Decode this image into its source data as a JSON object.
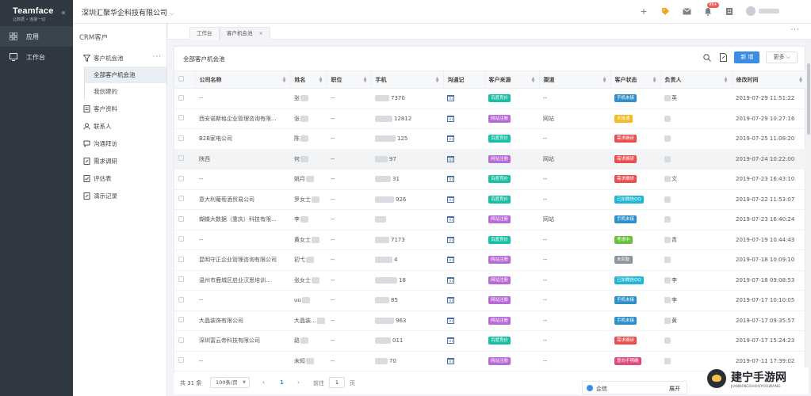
{
  "brand": {
    "name": "Teamface",
    "slogan": "让数据 • 连接一切"
  },
  "rail": {
    "items": [
      {
        "label": "应用"
      },
      {
        "label": "工作台"
      }
    ]
  },
  "header": {
    "company": "深圳汇聚华企科技有限公司",
    "notify_badge": "99+"
  },
  "module": {
    "title": "CRM客户",
    "group_label": "客户机会池",
    "sub_items": [
      {
        "label": "全部客户机会池"
      },
      {
        "label": "我创建的"
      }
    ],
    "items": [
      {
        "label": "客户资料"
      },
      {
        "label": "联系人"
      },
      {
        "label": "沟通拜访"
      },
      {
        "label": "需求调研"
      },
      {
        "label": "评估表"
      },
      {
        "label": "演示记录"
      }
    ]
  },
  "tabs": [
    {
      "label": "工作台"
    },
    {
      "label": "客户机会池"
    }
  ],
  "panel": {
    "title": "全部客户机会池",
    "new_label": "新 增",
    "more_label": "更多"
  },
  "table": {
    "columns": [
      "公司名称",
      "姓名",
      "职位",
      "手机",
      "沟通记",
      "客户来源",
      "渠道",
      "客户状态",
      "负责人",
      "修改时间"
    ],
    "rows": [
      {
        "company": "--",
        "name": "张",
        "title": "--",
        "phone": "7370",
        "source": "百度竞价",
        "channel": "--",
        "status": "手机未接",
        "owner": "英",
        "time": "2019-07-29 11:51:22"
      },
      {
        "company": "西安诺斯格企业管理咨询有限...",
        "name": "张",
        "title": "--",
        "phone": "12812",
        "source": "网站注册",
        "channel": "网站",
        "status": "未接通",
        "owner": "",
        "time": "2019-07-29 10:27:16"
      },
      {
        "company": "B2B家电公司",
        "name": "陈",
        "title": "--",
        "phone": "125",
        "source": "百度竞价",
        "channel": "--",
        "status": "需求确研",
        "owner": "",
        "time": "2019-07-25 11:08:20"
      },
      {
        "company": "陕西",
        "name": "何",
        "title": "--",
        "phone": "97",
        "source": "网站注册",
        "channel": "网站",
        "status": "需求确研",
        "owner": "",
        "time": "2019-07-24 10:22:00"
      },
      {
        "company": "--",
        "name": "姚月",
        "title": "--",
        "phone": "31",
        "source": "百度竞价",
        "channel": "--",
        "status": "需求确研",
        "owner": "文",
        "time": "2019-07-23 16:43:10"
      },
      {
        "company": "意大利葡萄酒贸易公司",
        "name": "罗女士",
        "title": "--",
        "phone": "926",
        "source": "百度竞价",
        "channel": "--",
        "status": "已加微信QQ",
        "owner": "",
        "time": "2019-07-22 11:53:07"
      },
      {
        "company": "蝴蝶大数据（重庆）科技有限...",
        "name": "李",
        "title": "--",
        "phone": "",
        "source": "网站注册",
        "channel": "网站",
        "status": "手机未接",
        "owner": "",
        "time": "2019-07-23 16:40:24"
      },
      {
        "company": "--",
        "name": "黄女士",
        "title": "--",
        "phone": "7173",
        "source": "百度竞价",
        "channel": "--",
        "status": "考虑中",
        "owner": "青",
        "time": "2019-07-19 10:44:43"
      },
      {
        "company": "昆明守正企业管理咨询有限公司",
        "name": "初弋",
        "title": "--",
        "phone": "4",
        "source": "网站注册",
        "channel": "--",
        "status": "未回复",
        "owner": "",
        "time": "2019-07-18 10:09:10"
      },
      {
        "company": "温州市鹿城区启业汉思培训...",
        "name": "张女士",
        "title": "--",
        "phone": "18",
        "source": "网站注册",
        "channel": "--",
        "status": "已加微信QQ",
        "owner": "李",
        "time": "2019-07-18 09:08:53"
      },
      {
        "company": "--",
        "name": "uu",
        "title": "--",
        "phone": "85",
        "source": "网站注册",
        "channel": "--",
        "status": "手机未接",
        "owner": "李",
        "time": "2019-07-17 10:10:05"
      },
      {
        "company": "大晶装饰有限公司",
        "name": "大晶装...",
        "title": "--",
        "phone": "963",
        "source": "网站注册",
        "channel": "--",
        "status": "手机未接",
        "owner": "黄",
        "time": "2019-07-17 09:35:57"
      },
      {
        "company": "深圳富云帝科技有限公司",
        "name": "路",
        "title": "--",
        "phone": "011",
        "source": "百度竞价",
        "channel": "--",
        "status": "需求确研",
        "owner": "",
        "time": "2019-07-17 15:24:23"
      },
      {
        "company": "--",
        "name": "未知",
        "title": "--",
        "phone": "70",
        "source": "网站注册",
        "channel": "--",
        "status": "意向不明确",
        "owner": "",
        "time": "2019-07-11 17:39:02"
      }
    ]
  },
  "status_colors": {
    "手机未接": "#2e8fc9",
    "未接通": "#f5b921",
    "需求确研": "#ea4e4e",
    "已加微信QQ": "#20b6d6",
    "考虑中": "#67c23a",
    "未回复": "#8d949c",
    "意向不明确": "#e0497a"
  },
  "source_colors": {
    "百度竞价": "#19bfa4",
    "网站注册": "#b86ad6"
  },
  "footer": {
    "total": "共 31 条",
    "page_size": "100条/页",
    "current_page": "1",
    "goto_label": "前往",
    "goto_value": "1",
    "page_suffix": "页"
  },
  "im": {
    "label": "企信",
    "expand": "展开"
  },
  "watermark": {
    "text": "建宁手游网",
    "sub": "JIANNINGSHOUYOUWANG"
  }
}
